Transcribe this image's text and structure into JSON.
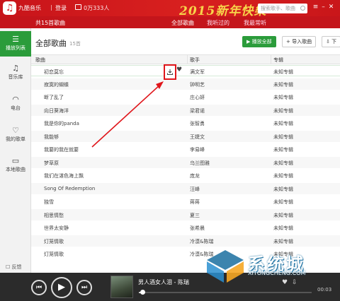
{
  "header": {
    "logo_icon": "music-note-icon",
    "app_title": "九酷音乐",
    "separator": "|",
    "login": "登录",
    "online_count": "0万333人",
    "banner": "2015新年快樂",
    "search_placeholder": "搜索歌手、歌曲",
    "window_buttons": [
      "menu-icon",
      "minimize-icon",
      "maximize-icon",
      "close-icon"
    ]
  },
  "subheader": {
    "song_count": "共15首歌曲",
    "tabs": [
      "全部歌曲",
      "我听过的",
      "我最常听"
    ]
  },
  "sidebar": {
    "items": [
      {
        "icon": "list-icon",
        "label": "播放列表"
      },
      {
        "icon": "music-note-icon",
        "label": "音乐库"
      },
      {
        "icon": "wifi-icon",
        "label": "电台"
      },
      {
        "icon": "heart-icon",
        "label": "我的歌单"
      },
      {
        "icon": "monitor-icon",
        "label": "本地歌曲"
      }
    ],
    "feedback": "反馈"
  },
  "main": {
    "list_title": "全部歌曲",
    "list_count": "15首",
    "play_all": "播放全部",
    "import": "+ 导入歌曲",
    "download": "下",
    "columns": [
      "歌曲",
      "歌手",
      "专辑"
    ],
    "rows": [
      {
        "song": "初恋莫忘",
        "artist": "满文军",
        "album": "未知专辑"
      },
      {
        "song": "寂寞的蝴蝶",
        "artist": "钟明艺",
        "album": "未知专辑"
      },
      {
        "song": "断了乱了",
        "artist": "庄心妍",
        "album": "未知专辑"
      },
      {
        "song": "向日葵海洋",
        "artist": "梁君诺",
        "album": "未知专辑"
      },
      {
        "song": "我是你的panda",
        "artist": "张智勇",
        "album": "未知专辑"
      },
      {
        "song": "我能够",
        "artist": "王婕文",
        "album": "未知专辑"
      },
      {
        "song": "我要的我在就要",
        "artist": "李易峰",
        "album": "未知专辑"
      },
      {
        "song": "梦草原",
        "artist": "乌兰图雅",
        "album": "未知专辑"
      },
      {
        "song": "我们在湛色海上飘",
        "artist": "庞龙",
        "album": "未知专辑"
      },
      {
        "song": "Song Of Redemption",
        "artist": "汪峰",
        "album": "未知专辑"
      },
      {
        "song": "独雪",
        "artist": "蒋蒋",
        "album": "未知专辑"
      },
      {
        "song": "相思情愁",
        "artist": "夏三",
        "album": "未知专辑"
      },
      {
        "song": "世界太安静",
        "artist": "张希晨",
        "album": "未知专辑"
      },
      {
        "song": "灯笼情歌",
        "artist": "冷漠&陈瑞",
        "album": "未知专辑"
      },
      {
        "song": "灯笼情歌",
        "artist": "冷漠&陈瑞",
        "album": "未知专辑"
      }
    ]
  },
  "player": {
    "now_playing": "男人酒女人泪 - 陈瑞",
    "time": "00:03",
    "progress": 0.02
  },
  "watermark": {
    "text": "系统城",
    "url": "XITONGCHENG.COM"
  },
  "colors": {
    "header_red": "#d31d1f",
    "accent_green": "#2b9c3b",
    "highlight_red": "#e0161b"
  }
}
